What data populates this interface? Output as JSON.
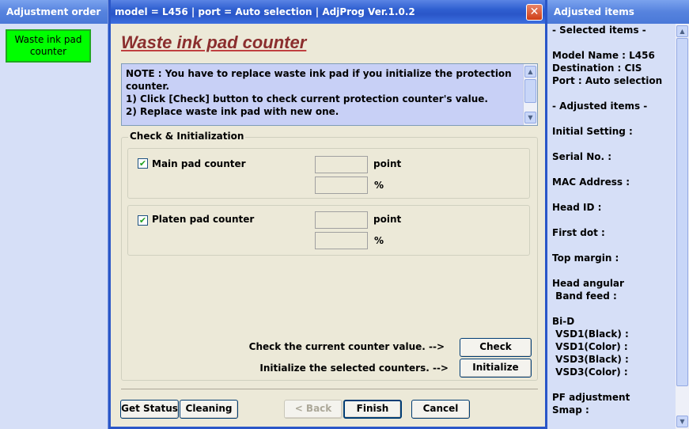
{
  "left_pane": {
    "title": "Adjustment order",
    "button_line1": "Waste ink pad",
    "button_line2": "counter"
  },
  "window": {
    "title": "model = L456  |  port = Auto selection  |  AdjProg Ver.1.0.2",
    "close_glyph": "✕",
    "heading": "Waste ink pad counter",
    "note": [
      "NOTE : You have to replace waste ink pad if you initialize the protection",
      "counter.",
      "1) Click [Check] button to check current protection counter's value.",
      "2) Replace waste ink pad with new one."
    ],
    "group_label": "Check & Initialization",
    "main_pad": {
      "label": "Main pad counter",
      "checked": true,
      "point_value": "",
      "percent_value": "",
      "point_unit": "point",
      "percent_unit": "%"
    },
    "platen_pad": {
      "label": "Platen pad counter",
      "checked": true,
      "point_value": "",
      "percent_value": "",
      "point_unit": "point",
      "percent_unit": "%"
    },
    "check_hint": "Check the current counter value.  -->",
    "check_button": "Check",
    "init_hint": "Initialize the selected counters.  -->",
    "init_button": "Initialize",
    "buttons": {
      "get_status": "Get Status",
      "cleaning": "Cleaning",
      "back": "< Back",
      "finish": "Finish",
      "cancel": "Cancel"
    }
  },
  "right_pane": {
    "title": "Adjusted items",
    "lines": [
      "- Selected items -",
      "",
      "Model Name : L456",
      "Destination : CIS",
      "Port : Auto selection",
      "",
      "- Adjusted items -",
      "",
      "Initial Setting :",
      "",
      "Serial No. :",
      "",
      "MAC Address :",
      "",
      "Head ID :",
      "",
      "First dot :",
      "",
      "Top margin :",
      "",
      "Head angular",
      " Band feed :",
      "",
      "Bi-D",
      " VSD1(Black) :",
      " VSD1(Color) :",
      " VSD3(Black) :",
      " VSD3(Color) :",
      "",
      "PF adjustment",
      "Smap :"
    ]
  },
  "colors": {
    "accent_green": "#00ff00",
    "heading_color": "#8b2e2e",
    "title_bar_blue": "#2a56c8"
  }
}
